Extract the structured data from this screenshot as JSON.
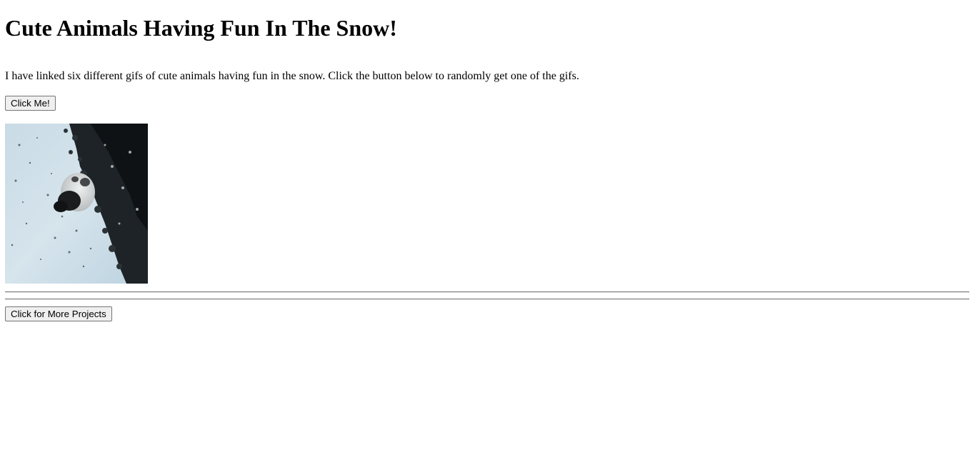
{
  "page": {
    "title": "Cute Animals Having Fun In The Snow!",
    "intro": "I have linked six different gifs of cute animals having fun in the snow. Click the button below to randomly get one of the gifs."
  },
  "buttons": {
    "random_gif_label": "Click Me!",
    "more_projects_label": "Click for More Projects"
  },
  "gif": {
    "alt": "Panda rolling in the snow"
  }
}
